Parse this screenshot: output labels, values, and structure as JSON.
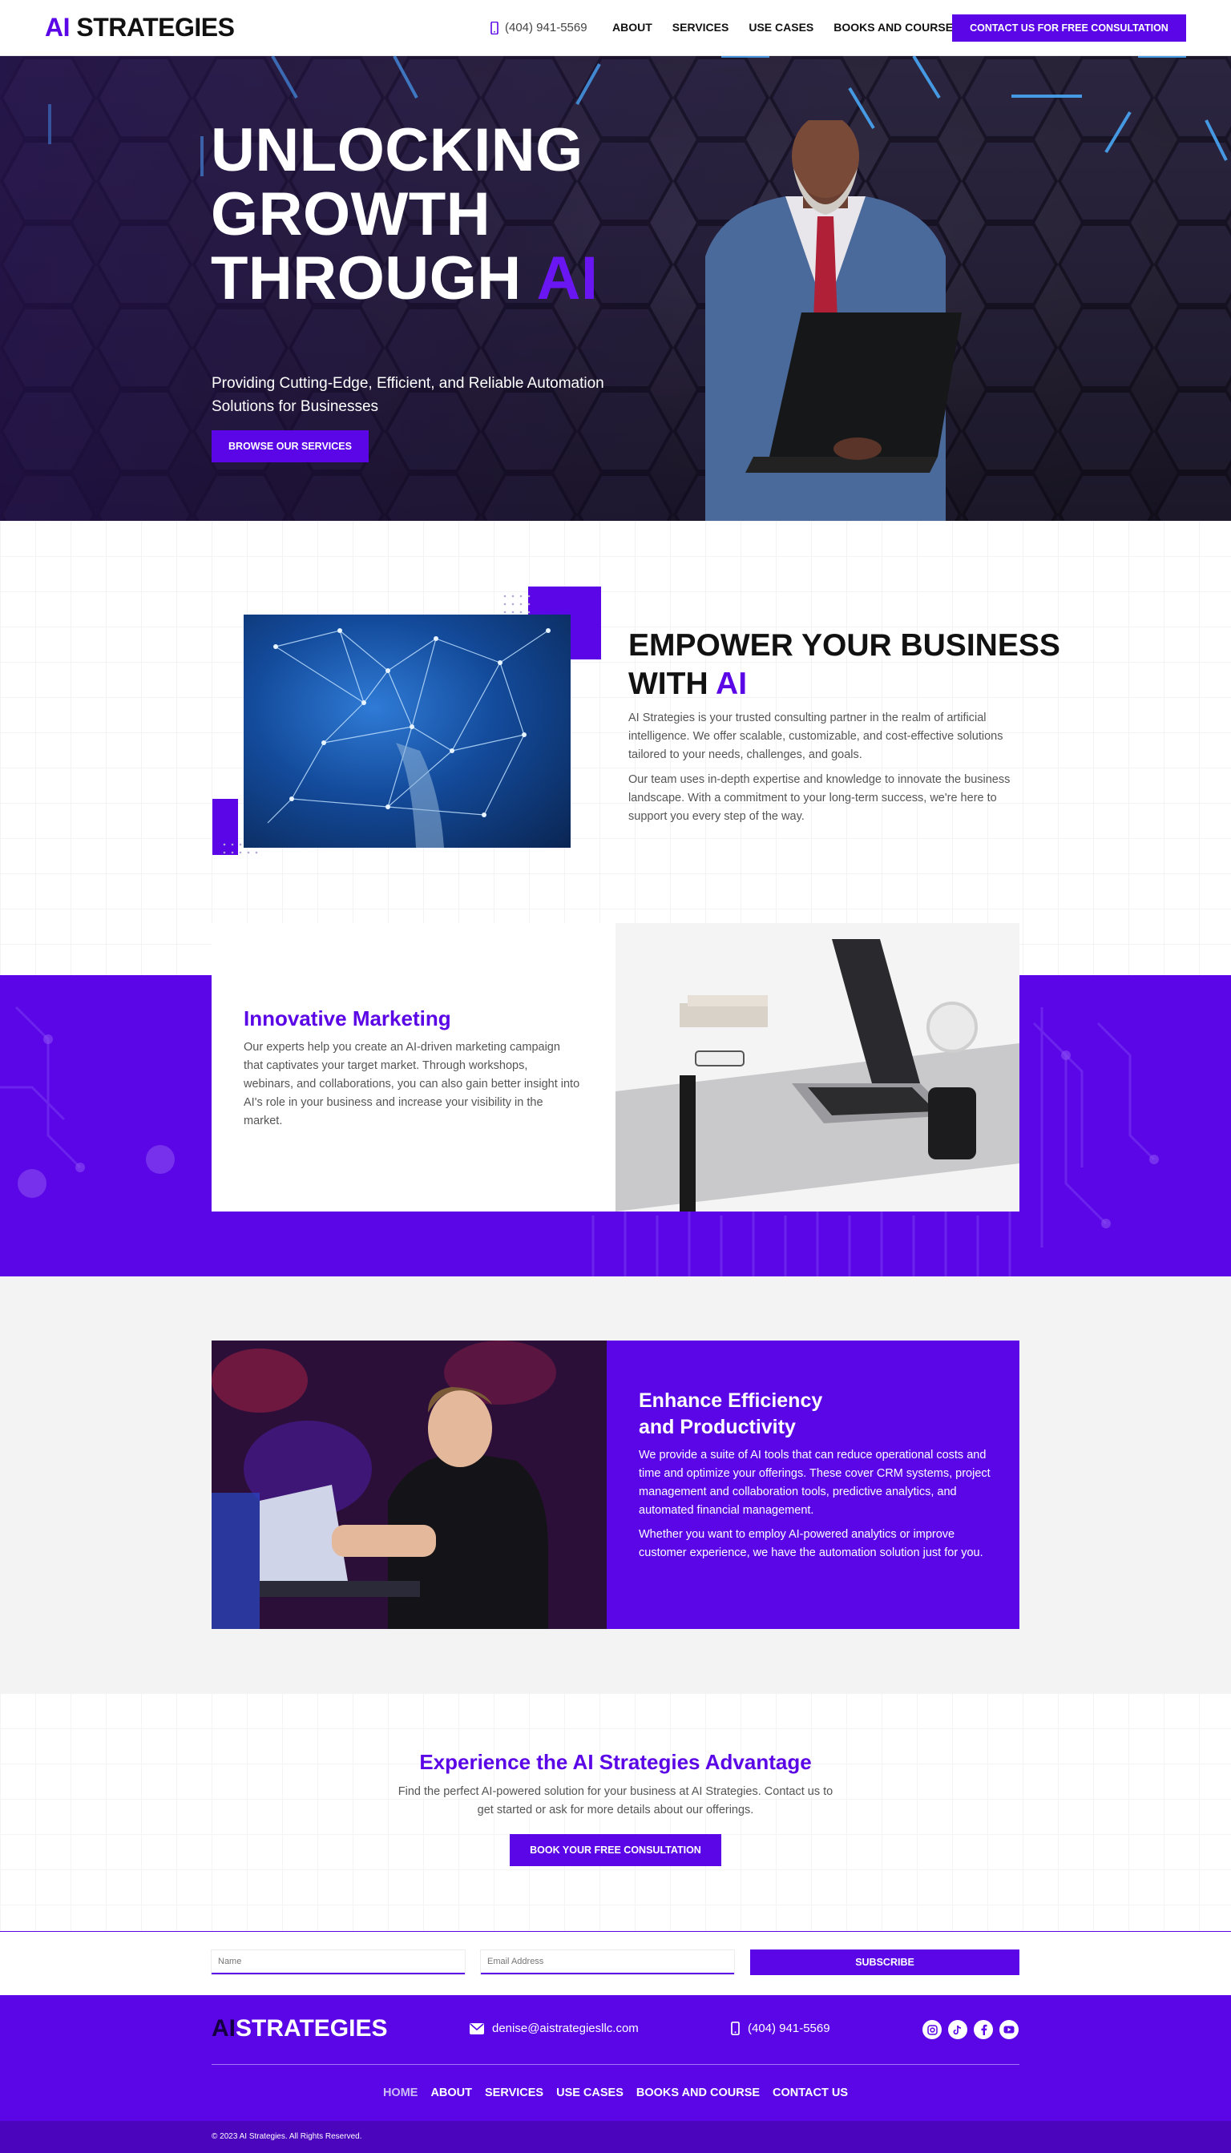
{
  "header": {
    "logo_ai": "AI",
    "logo_rest": " STRATEGIES",
    "phone": "(404) 941-5569",
    "nav": [
      "ABOUT",
      "SERVICES",
      "USE CASES",
      "BOOKS AND COURSE"
    ],
    "cta": "CONTACT US FOR FREE CONSULTATION"
  },
  "hero": {
    "title_line1": "UNLOCKING",
    "title_line2": "GROWTH",
    "title_line3": "THROUGH ",
    "title_ai": "AI",
    "subtitle": "Providing Cutting-Edge, Efficient, and Reliable Automation Solutions for Businesses",
    "button": "BROWSE OUR SERVICES"
  },
  "empower": {
    "title_line1": "EMPOWER YOUR BUSINESS",
    "title_line2": "WITH ",
    "title_ai": "AI",
    "p1": "AI Strategies is your trusted consulting partner in the realm of artificial intelligence. We offer scalable, customizable, and cost-effective solutions tailored to your needs, challenges, and goals.",
    "p2": "Our team uses in-depth expertise and knowledge to innovate the business landscape. With a commitment to your long-term success, we're here to support you every step of the way."
  },
  "marketing": {
    "title": "Innovative Marketing",
    "body": "Our experts help you create an AI-driven marketing campaign that captivates your target market. Through workshops, webinars, and collaborations, you can also gain better insight into AI's role in your business and increase your visibility in the market."
  },
  "efficiency": {
    "title_line1": "Enhance Efficiency",
    "title_line2": "and Productivity",
    "p1": "We provide a suite of AI tools that can reduce operational costs and time and optimize your offerings. These cover CRM systems, project management and collaboration tools, predictive analytics, and automated financial management.",
    "p2": "Whether you want to employ AI-powered analytics or improve customer experience, we have the automation solution just for you."
  },
  "advantage": {
    "title": "Experience the AI Strategies Advantage",
    "body": "Find the perfect AI-powered solution for your business at AI Strategies. Contact us to get started or ask for more details about our offerings.",
    "button": "BOOK YOUR FREE CONSULTATION"
  },
  "subscribe": {
    "name_placeholder": "Name",
    "email_placeholder": "Email Address",
    "button": "SUBSCRIBE"
  },
  "footer": {
    "logo_ai": "AI",
    "logo_rest": "STRATEGIES",
    "email": "denise@aistrategiesllc.com",
    "phone": "(404) 941-5569",
    "social_icons": [
      "instagram-icon",
      "tiktok-icon",
      "facebook-icon",
      "youtube-icon"
    ],
    "nav": [
      "HOME",
      "ABOUT",
      "SERVICES",
      "USE CASES",
      "BOOKS AND COURSE",
      "CONTACT US"
    ],
    "copyright": "© 2023 AI Strategies. All Rights Reserved."
  },
  "colors": {
    "brand": "#5b06e6",
    "dark": "#111111"
  }
}
